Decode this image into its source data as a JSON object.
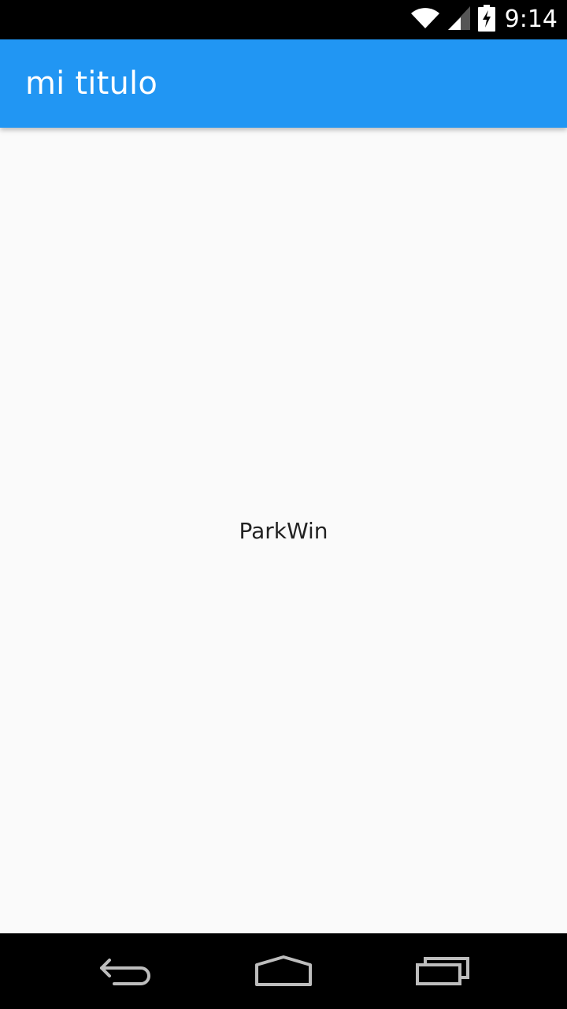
{
  "status_bar": {
    "time": "9:14",
    "icons": [
      "wifi-icon",
      "signal-icon",
      "battery-charging-icon"
    ]
  },
  "app_bar": {
    "title": "mi titulo",
    "color": "#2196f3"
  },
  "main": {
    "center_text": "ParkWin"
  },
  "nav_bar": {
    "buttons": [
      "back-icon",
      "home-icon",
      "recents-icon"
    ]
  }
}
